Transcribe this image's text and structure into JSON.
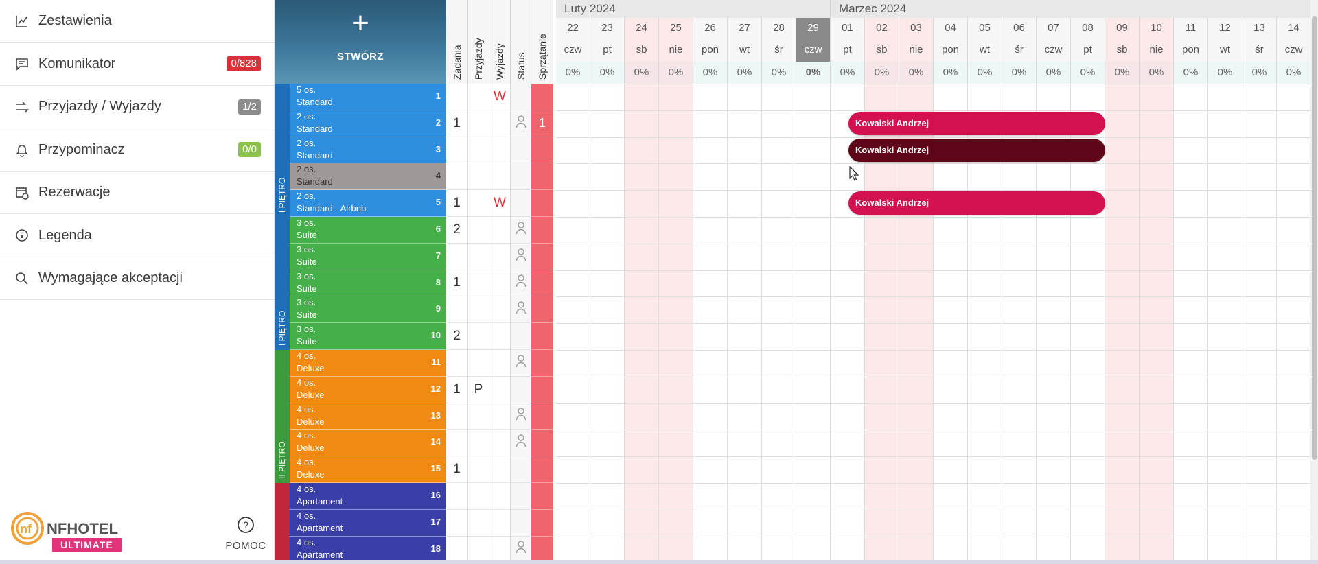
{
  "menu": [
    {
      "label": "Zestawienia",
      "icon": "chart-line-icon",
      "badge": null
    },
    {
      "label": "Komunikator",
      "icon": "chat-icon",
      "badge": "0/828",
      "badge_color": "#d9303a"
    },
    {
      "label": "Przyjazdy / Wyjazdy",
      "icon": "arrivals-departures-icon",
      "badge": "1/2",
      "badge_color": "#8c8c8c"
    },
    {
      "label": "Przypominacz",
      "icon": "bell-icon",
      "badge": "0/0",
      "badge_color": "#8bc34a"
    },
    {
      "label": "Rezerwacje",
      "icon": "calendar-clock-icon",
      "badge": null
    },
    {
      "label": "Legenda",
      "icon": "info-icon",
      "badge": null
    },
    {
      "label": "Wymagające akceptacji",
      "icon": "search-icon",
      "badge": null
    }
  ],
  "logo": {
    "brand": "NFHOTEL",
    "edition": "ULTIMATE"
  },
  "help": {
    "label": "POMOC"
  },
  "create_button": {
    "label": "STWÓRZ",
    "icon": "plus-icon"
  },
  "columns": [
    "Zadania",
    "Przyjazdy",
    "Wyjazdy",
    "Status",
    "Sprzątanie"
  ],
  "months": [
    {
      "label": "Luty 2024",
      "days": 8
    },
    {
      "label": "Marzec 2024",
      "days": 14
    }
  ],
  "days": [
    {
      "num": "22",
      "dow": "czw",
      "occ": "0%",
      "weekend": false,
      "today": false
    },
    {
      "num": "23",
      "dow": "pt",
      "occ": "0%",
      "weekend": false,
      "today": false
    },
    {
      "num": "24",
      "dow": "sb",
      "occ": "0%",
      "weekend": true,
      "today": false
    },
    {
      "num": "25",
      "dow": "nie",
      "occ": "0%",
      "weekend": true,
      "today": false
    },
    {
      "num": "26",
      "dow": "pon",
      "occ": "0%",
      "weekend": false,
      "today": false
    },
    {
      "num": "27",
      "dow": "wt",
      "occ": "0%",
      "weekend": false,
      "today": false
    },
    {
      "num": "28",
      "dow": "śr",
      "occ": "0%",
      "weekend": false,
      "today": false
    },
    {
      "num": "29",
      "dow": "czw",
      "occ": "0%",
      "weekend": false,
      "today": true
    },
    {
      "num": "01",
      "dow": "pt",
      "occ": "0%",
      "weekend": false,
      "today": false
    },
    {
      "num": "02",
      "dow": "sb",
      "occ": "0%",
      "weekend": true,
      "today": false
    },
    {
      "num": "03",
      "dow": "nie",
      "occ": "0%",
      "weekend": true,
      "today": false
    },
    {
      "num": "04",
      "dow": "pon",
      "occ": "0%",
      "weekend": false,
      "today": false
    },
    {
      "num": "05",
      "dow": "wt",
      "occ": "0%",
      "weekend": false,
      "today": false
    },
    {
      "num": "06",
      "dow": "śr",
      "occ": "0%",
      "weekend": false,
      "today": false
    },
    {
      "num": "07",
      "dow": "czw",
      "occ": "0%",
      "weekend": false,
      "today": false
    },
    {
      "num": "08",
      "dow": "pt",
      "occ": "0%",
      "weekend": false,
      "today": false
    },
    {
      "num": "09",
      "dow": "sb",
      "occ": "0%",
      "weekend": true,
      "today": false
    },
    {
      "num": "10",
      "dow": "nie",
      "occ": "0%",
      "weekend": true,
      "today": false
    },
    {
      "num": "11",
      "dow": "pon",
      "occ": "0%",
      "weekend": false,
      "today": false
    },
    {
      "num": "12",
      "dow": "wt",
      "occ": "0%",
      "weekend": false,
      "today": false
    },
    {
      "num": "13",
      "dow": "śr",
      "occ": "0%",
      "weekend": false,
      "today": false
    },
    {
      "num": "14",
      "dow": "czw",
      "occ": "0%",
      "weekend": false,
      "today": false
    }
  ],
  "floors": [
    {
      "label": "I PIĘTRO",
      "color": "#1f6fb8",
      "rooms": 5
    },
    {
      "label": "I PIĘTRO",
      "color": "#1f6fb8",
      "rooms": 5
    },
    {
      "label": "II PIĘTRO",
      "color": "#3b9a3b",
      "rooms": 5
    },
    {
      "label": "",
      "color": "#c0283a",
      "rooms": 3
    }
  ],
  "rooms": [
    {
      "line1": "5 os.",
      "line2": "Standard",
      "num": "1",
      "color": "#2e8fe0",
      "text_color": "#ffffff"
    },
    {
      "line1": "2 os.",
      "line2": "Standard",
      "num": "2",
      "color": "#2e8fe0",
      "text_color": "#ffffff"
    },
    {
      "line1": "2 os.",
      "line2": "Standard",
      "num": "3",
      "color": "#2e8fe0",
      "text_color": "#ffffff"
    },
    {
      "line1": "2 os.",
      "line2": "Standard",
      "num": "4",
      "color": "#9e9898",
      "text_color": "#333333"
    },
    {
      "line1": "2 os.",
      "line2": "Standard - Airbnb",
      "num": "5",
      "color": "#2e8fe0",
      "text_color": "#ffffff"
    },
    {
      "line1": "3 os.",
      "line2": "Suite",
      "num": "6",
      "color": "#45b04a",
      "text_color": "#ffffff"
    },
    {
      "line1": "3 os.",
      "line2": "Suite",
      "num": "7",
      "color": "#45b04a",
      "text_color": "#ffffff"
    },
    {
      "line1": "3 os.",
      "line2": "Suite",
      "num": "8",
      "color": "#45b04a",
      "text_color": "#ffffff"
    },
    {
      "line1": "3 os.",
      "line2": "Suite",
      "num": "9",
      "color": "#45b04a",
      "text_color": "#ffffff"
    },
    {
      "line1": "3 os.",
      "line2": "Suite",
      "num": "10",
      "color": "#45b04a",
      "text_color": "#ffffff"
    },
    {
      "line1": "4 os.",
      "line2": "Deluxe",
      "num": "11",
      "color": "#f08a12",
      "text_color": "#ffffff"
    },
    {
      "line1": "4 os.",
      "line2": "Deluxe",
      "num": "12",
      "color": "#f08a12",
      "text_color": "#ffffff"
    },
    {
      "line1": "4 os.",
      "line2": "Deluxe",
      "num": "13",
      "color": "#f08a12",
      "text_color": "#ffffff"
    },
    {
      "line1": "4 os.",
      "line2": "Deluxe",
      "num": "14",
      "color": "#f08a12",
      "text_color": "#ffffff"
    },
    {
      "line1": "4 os.",
      "line2": "Deluxe",
      "num": "15",
      "color": "#f08a12",
      "text_color": "#ffffff"
    },
    {
      "line1": "4 os.",
      "line2": "Apartament",
      "num": "16",
      "color": "#3a3fa8",
      "text_color": "#ffffff"
    },
    {
      "line1": "4 os.",
      "line2": "Apartament",
      "num": "17",
      "color": "#3a3fa8",
      "text_color": "#ffffff"
    },
    {
      "line1": "4 os.",
      "line2": "Apartament",
      "num": "18",
      "color": "#3a3fa8",
      "text_color": "#ffffff"
    }
  ],
  "row_info": [
    {
      "zadania": "",
      "przyjazdy": "",
      "wyjazdy": "W",
      "status": false,
      "sprzatanie": "",
      "flag": true
    },
    {
      "zadania": "1",
      "przyjazdy": "",
      "wyjazdy": "",
      "status": true,
      "sprzatanie": "1",
      "flag": false
    },
    {
      "zadania": "",
      "przyjazdy": "",
      "wyjazdy": "",
      "status": false,
      "sprzatanie": "",
      "flag": false
    },
    {
      "zadania": "",
      "przyjazdy": "",
      "wyjazdy": "",
      "status": false,
      "sprzatanie": "",
      "flag": false
    },
    {
      "zadania": "1",
      "przyjazdy": "",
      "wyjazdy": "W",
      "status": false,
      "sprzatanie": "",
      "flag": true
    },
    {
      "zadania": "2",
      "przyjazdy": "",
      "wyjazdy": "",
      "status": true,
      "sprzatanie": "",
      "flag": false
    },
    {
      "zadania": "",
      "przyjazdy": "",
      "wyjazdy": "",
      "status": true,
      "sprzatanie": "",
      "flag": false
    },
    {
      "zadania": "1",
      "przyjazdy": "",
      "wyjazdy": "",
      "status": true,
      "sprzatanie": "",
      "flag": false
    },
    {
      "zadania": "",
      "przyjazdy": "",
      "wyjazdy": "",
      "status": true,
      "sprzatanie": "",
      "flag": false
    },
    {
      "zadania": "2",
      "przyjazdy": "",
      "wyjazdy": "",
      "status": false,
      "sprzatanie": "",
      "flag": false
    },
    {
      "zadania": "",
      "przyjazdy": "",
      "wyjazdy": "",
      "status": true,
      "sprzatanie": "",
      "flag": false
    },
    {
      "zadania": "1",
      "przyjazdy": "P",
      "wyjazdy": "",
      "status": false,
      "sprzatanie": "",
      "flag": false
    },
    {
      "zadania": "",
      "przyjazdy": "",
      "wyjazdy": "",
      "status": true,
      "sprzatanie": "",
      "flag": false
    },
    {
      "zadania": "",
      "przyjazdy": "",
      "wyjazdy": "",
      "status": true,
      "sprzatanie": "",
      "flag": false
    },
    {
      "zadania": "1",
      "przyjazdy": "",
      "wyjazdy": "",
      "status": false,
      "sprzatanie": "",
      "flag": false
    },
    {
      "zadania": "",
      "przyjazdy": "",
      "wyjazdy": "",
      "status": false,
      "sprzatanie": "",
      "flag": false
    },
    {
      "zadania": "",
      "przyjazdy": "",
      "wyjazdy": "",
      "status": false,
      "sprzatanie": "",
      "flag": false
    },
    {
      "zadania": "",
      "przyjazdy": "",
      "wyjazdy": "",
      "status": true,
      "sprzatanie": "",
      "flag": false
    }
  ],
  "bookings": [
    {
      "guest": "Kowalski Andrzej",
      "room": "2",
      "start_day": "01",
      "end_day": "08",
      "color": "#d3114f"
    },
    {
      "guest": "Kowalski Andrzej",
      "room": "3",
      "start_day": "01",
      "end_day": "08",
      "color": "#5e0618"
    },
    {
      "guest": "Kowalski Andrzej",
      "room": "5",
      "start_day": "01",
      "end_day": "08",
      "color": "#d3114f"
    }
  ]
}
